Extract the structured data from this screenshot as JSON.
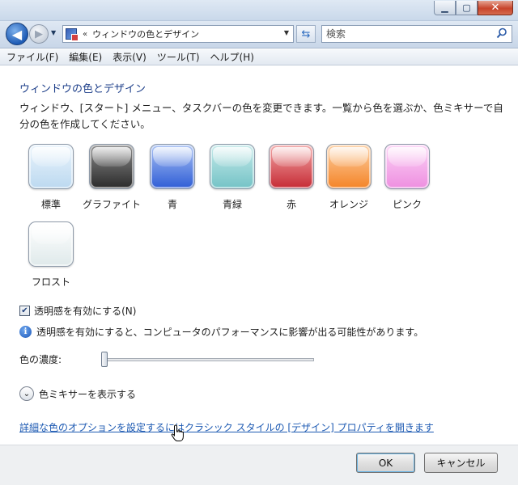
{
  "window": {
    "caption_buttons": [
      {
        "name": "minimize",
        "glyph": "▁"
      },
      {
        "name": "maximize",
        "glyph": "▢"
      },
      {
        "name": "close",
        "glyph": "✕"
      }
    ]
  },
  "navbar": {
    "back_glyph": "◀",
    "forward_glyph": "▶",
    "dropdown_glyph": "▼",
    "address_separator": "«",
    "address_text": "ウィンドウの色とデザイン",
    "refresh_glyph": "⇆",
    "search_placeholder": "検索"
  },
  "menu": {
    "items": [
      "ファイル(F)",
      "編集(E)",
      "表示(V)",
      "ツール(T)",
      "ヘルプ(H)"
    ]
  },
  "main": {
    "title": "ウィンドウの色とデザイン",
    "description": "ウィンドウ、[スタート] メニュー、タスクバーの色を変更できます。一覧から色を選ぶか、色ミキサーで自分の色を作成してください。",
    "swatches": [
      {
        "label": "標準",
        "color_top": "#eaf4fc",
        "color_bottom": "#bcd9f0"
      },
      {
        "label": "グラファイト",
        "color_top": "#8a8a8a",
        "color_bottom": "#2b2b2b"
      },
      {
        "label": "青",
        "color_top": "#a9c1f4",
        "color_bottom": "#2f5ed6"
      },
      {
        "label": "青緑",
        "color_top": "#c6eaea",
        "color_bottom": "#74c3c6"
      },
      {
        "label": "赤",
        "color_top": "#f2a6a6",
        "color_bottom": "#c62b35"
      },
      {
        "label": "オレンジ",
        "color_top": "#fdd0a3",
        "color_bottom": "#f48427"
      },
      {
        "label": "ピンク",
        "color_top": "#fcd3f6",
        "color_bottom": "#ee8fe0"
      },
      {
        "label": "フロスト",
        "color_top": "#ffffff",
        "color_bottom": "#dfe9ea"
      }
    ],
    "transparency_checkbox": {
      "label": "透明感を有効にする(N)",
      "checked": true,
      "check_glyph": "✔"
    },
    "info_glyph": "i",
    "info_text": "透明感を有効にすると、コンピュータのパフォーマンスに影響が出る可能性があります。",
    "intensity_label": "色の濃度:",
    "intensity_value": 0,
    "mixer_glyph": "⌄",
    "mixer_label": "色ミキサーを表示する",
    "advanced_link": "詳細な色のオプションを設定するにはクラシック スタイルの [デザイン] プロパティを開きます"
  },
  "footer": {
    "ok_label": "OK",
    "cancel_label": "キャンセル"
  },
  "colors": {
    "accent_title": "#1e3f8a",
    "link": "#1c59b2"
  }
}
